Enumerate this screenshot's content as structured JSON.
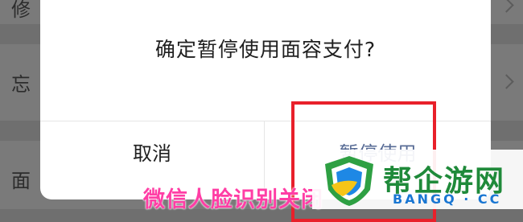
{
  "background": {
    "rows": [
      {
        "label": "修"
      },
      {
        "label": "忘"
      },
      {
        "label": "面"
      }
    ]
  },
  "dialog": {
    "title": "确定暂停使用面容支付?",
    "cancel_label": "取消",
    "confirm_label": "暂停使用",
    "confirm_color": "#576b95"
  },
  "highlight_color": "#e8202a",
  "caption": "微信人脸识别关闭",
  "watermark": {
    "name": "帮企游网",
    "domain": "BANGQ · CC"
  }
}
